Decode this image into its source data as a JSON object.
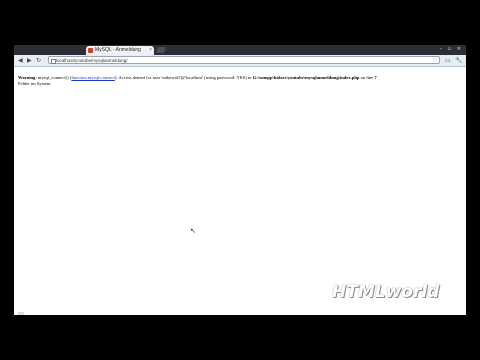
{
  "browser": {
    "tab": {
      "title": "MySQL - Anmeldung",
      "close": "×"
    },
    "window_controls": "– ▫ ×",
    "nav": {
      "back": "◀",
      "forward": "▶",
      "reload": "↻"
    },
    "address": {
      "url": "localhost/youtube/mysqlanmeldung/",
      "star": "☆"
    },
    "toolbar_icons": {
      "page": "page-icon",
      "wrench": "🔧"
    }
  },
  "page": {
    "warning_label": "Warning",
    "warning_func": ": mysql_connect() [",
    "warning_link": "function.mysql-connect",
    "warning_mid": "]: Access denied for user 'mikewolf'@'localhost' (using password: YES) in ",
    "warning_path": "G:\\xampp\\htdocs\\youtube\\mysqlanmeldung\\index.php",
    "warning_on_line": " on line ",
    "warning_line": "7",
    "second_line": "Fehler im System"
  },
  "watermark": "HTMLworld"
}
